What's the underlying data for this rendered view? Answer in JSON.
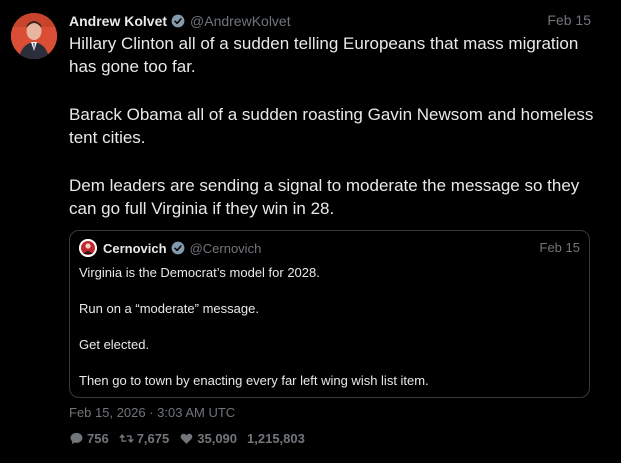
{
  "tweet": {
    "author_name": "Andrew Kolvet",
    "author_handle": "@AndrewKolvet",
    "date": "Feb 15",
    "paragraphs": [
      "Hillary Clinton all of a sudden telling Europeans that mass migration has gone too far.",
      "Barack Obama all of a sudden roasting Gavin Newsom and homeless tent cities.",
      "Dem leaders are sending a signal to moderate the message so they can go full Virginia if they win in 28."
    ],
    "timestamp": "Feb 15, 2026 · 3:03 AM UTC",
    "stats": {
      "replies": "756",
      "retweets": "7,675",
      "likes": "35,090",
      "views": "1,215,803"
    }
  },
  "quote": {
    "author_name": "Cernovich",
    "author_handle": "@Cernovich",
    "date": "Feb 15",
    "paragraphs": [
      "Virginia is the Democrat’s model for 2028.",
      "Run on a “moderate” message.",
      "Get elected.",
      "Then go to town by enacting every far left wing wish list item."
    ]
  },
  "colors": {
    "background": "#000000",
    "text": "#e7e9ea",
    "muted": "#71767b",
    "verified_badge": "#829aab",
    "quote_border": "#38383a",
    "avatar_accent": "#e2563c"
  },
  "icons": {
    "reply": "comment-icon",
    "retweet": "retweet-icon",
    "like": "heart-icon",
    "verified": "verified-badge-icon"
  }
}
